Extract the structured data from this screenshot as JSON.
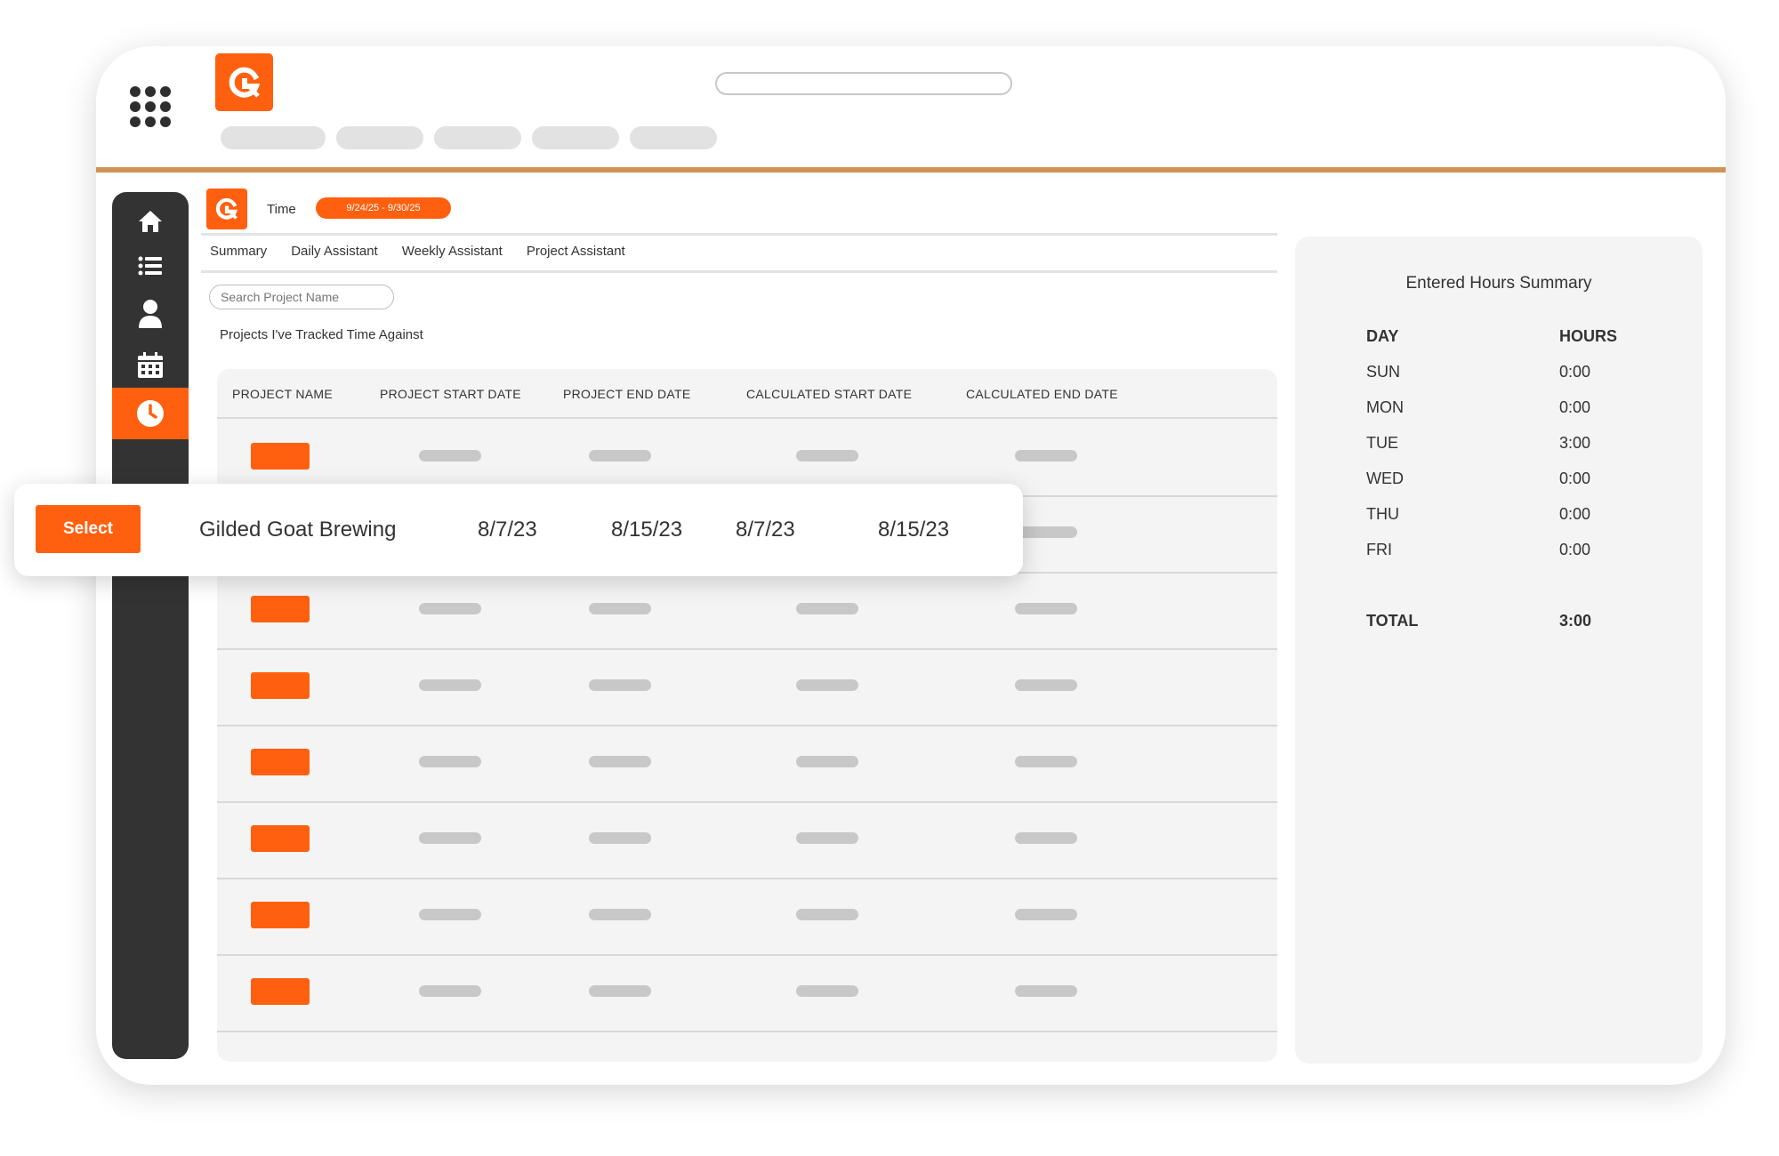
{
  "app": {
    "time_label": "Time",
    "date_range": "9/24/25 - 9/30/25"
  },
  "tabs": [
    "Summary",
    "Daily Assistant",
    "Weekly Assistant",
    "Project Assistant"
  ],
  "search": {
    "placeholder": "Search Project Name"
  },
  "section_title": "Projects I've Tracked Time Against",
  "table": {
    "headers": [
      "PROJECT NAME",
      "PROJECT START DATE",
      "PROJECT END DATE",
      "CALCULATED START DATE",
      "CALCULATED END DATE"
    ]
  },
  "popup": {
    "select_label": "Select",
    "project_name": "Gilded Goat Brewing",
    "project_start": "8/7/23",
    "project_end": "8/15/23",
    "calc_start": "8/7/23",
    "calc_end": "8/15/23"
  },
  "summary": {
    "title": "Entered Hours Summary",
    "day_header": "DAY",
    "hours_header": "HOURS",
    "rows": [
      {
        "day": "SUN",
        "hours": "0:00"
      },
      {
        "day": "MON",
        "hours": "0:00"
      },
      {
        "day": "TUE",
        "hours": "3:00"
      },
      {
        "day": "WED",
        "hours": "0:00"
      },
      {
        "day": "THU",
        "hours": "0:00"
      },
      {
        "day": "FRI",
        "hours": "0:00"
      }
    ],
    "total_label": "TOTAL",
    "total_hours": "3:00"
  },
  "colors": {
    "accent": "#ff6010",
    "sidebar": "#333333",
    "divider": "#cf9353",
    "panel": "#f4f4f4",
    "placeholder": "#c8c8c8"
  },
  "icons": {
    "launcher": "app-grid-icon",
    "brand": "brand-g-logo",
    "nav": [
      "home-icon",
      "list-icon",
      "user-icon",
      "calendar-icon",
      "clock-icon"
    ]
  }
}
